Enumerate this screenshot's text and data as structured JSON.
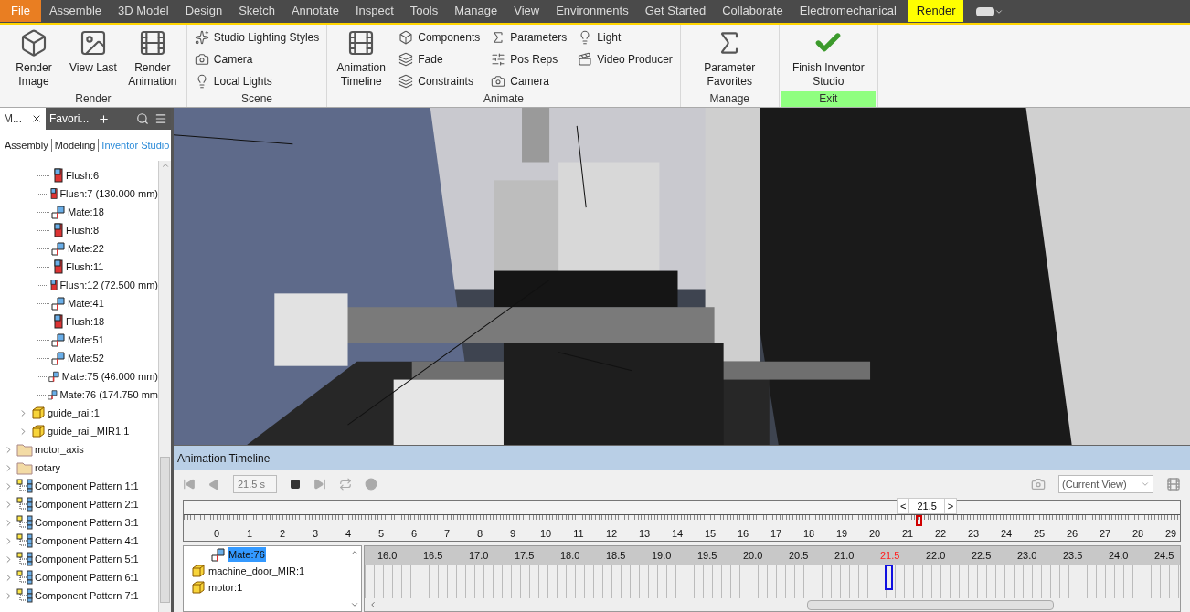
{
  "tabs": [
    {
      "label": "File",
      "kind": "file"
    },
    {
      "label": "Assemble",
      "kind": "tab",
      "selected": false
    },
    {
      "label": "3D Model",
      "kind": "tab",
      "selected": false
    },
    {
      "label": "Design",
      "kind": "tab",
      "selected": false
    },
    {
      "label": "Sketch",
      "kind": "tab",
      "selected": false
    },
    {
      "label": "Annotate",
      "kind": "tab",
      "selected": false
    },
    {
      "label": "Inspect",
      "kind": "tab",
      "selected": false
    },
    {
      "label": "Tools",
      "kind": "tab",
      "selected": false
    },
    {
      "label": "Manage",
      "kind": "tab",
      "selected": false
    },
    {
      "label": "View",
      "kind": "tab",
      "selected": false
    },
    {
      "label": "Environments",
      "kind": "tab",
      "selected": false
    },
    {
      "label": "Get Started",
      "kind": "tab",
      "selected": false
    },
    {
      "label": "Collaborate",
      "kind": "tab",
      "selected": false
    },
    {
      "label": "Electromechanical",
      "kind": "tab",
      "selected": false
    },
    {
      "label": "Render",
      "kind": "tab",
      "selected": true
    }
  ],
  "ribbon": [
    {
      "title": "Render",
      "highlighted": false,
      "tools": [
        {
          "kind": "large",
          "label": "Render Image"
        },
        {
          "kind": "large",
          "label": "View Last"
        },
        {
          "kind": "large",
          "label": "Render Animation"
        }
      ]
    },
    {
      "title": "Scene",
      "highlighted": false,
      "tools": [
        {
          "kind": "small",
          "label": "Studio Lighting Styles"
        },
        {
          "kind": "small",
          "label": "Camera"
        },
        {
          "kind": "small",
          "label": "Local Lights"
        }
      ]
    },
    {
      "title": "Animate",
      "highlighted": false,
      "tools": [
        {
          "kind": "large",
          "label": "Animation Timeline"
        },
        {
          "kind": "small",
          "label": "Components"
        },
        {
          "kind": "small",
          "label": "Fade"
        },
        {
          "kind": "small",
          "label": "Constraints"
        },
        {
          "kind": "small",
          "label": "Parameters"
        },
        {
          "kind": "small",
          "label": "Pos Reps"
        },
        {
          "kind": "small",
          "label": "Camera"
        },
        {
          "kind": "small",
          "label": "Light"
        },
        {
          "kind": "small",
          "label": "Video Producer"
        }
      ]
    },
    {
      "title": "Manage",
      "highlighted": false,
      "tools": [
        {
          "kind": "large",
          "label": "Parameter Favorites"
        }
      ]
    },
    {
      "title": "Exit",
      "highlighted": true,
      "tools": [
        {
          "kind": "large",
          "label": "Finish Inventor Studio"
        }
      ]
    }
  ],
  "browser": {
    "tabs": [
      {
        "label": "M...",
        "selected": true
      },
      {
        "label": "Favori...",
        "selected": false
      }
    ],
    "views": [
      {
        "label": "Assembly",
        "selected": false
      },
      {
        "label": "Modeling",
        "selected": false
      },
      {
        "label": "Inventor Studio",
        "selected": true
      }
    ],
    "constraints": [
      {
        "kind": "flush",
        "label": "Flush:6"
      },
      {
        "kind": "flush",
        "label": "Flush:7 (130.000 mm)"
      },
      {
        "kind": "mate",
        "label": "Mate:18"
      },
      {
        "kind": "flush",
        "label": "Flush:8"
      },
      {
        "kind": "mate",
        "label": "Mate:22"
      },
      {
        "kind": "flush",
        "label": "Flush:11"
      },
      {
        "kind": "flush",
        "label": "Flush:12 (72.500 mm)"
      },
      {
        "kind": "mate",
        "label": "Mate:41"
      },
      {
        "kind": "flush",
        "label": "Flush:18"
      },
      {
        "kind": "mate",
        "label": "Mate:51"
      },
      {
        "kind": "mate",
        "label": "Mate:52"
      },
      {
        "kind": "mate",
        "label": "Mate:75 (46.000 mm)"
      },
      {
        "kind": "mate",
        "label": "Mate:76 (174.750 mm"
      }
    ],
    "components": [
      {
        "kind": "part",
        "label": "guide_rail:1"
      },
      {
        "kind": "part",
        "label": "guide_rail_MIR1:1"
      }
    ],
    "nodes": [
      {
        "kind": "folder",
        "label": "motor_axis"
      },
      {
        "kind": "folder",
        "label": "rotary"
      },
      {
        "kind": "pattern",
        "label": "Component Pattern 1:1"
      },
      {
        "kind": "pattern",
        "label": "Component Pattern 2:1"
      },
      {
        "kind": "pattern",
        "label": "Component Pattern 3:1"
      },
      {
        "kind": "pattern",
        "label": "Component Pattern 4:1"
      },
      {
        "kind": "pattern",
        "label": "Component Pattern 5:1"
      },
      {
        "kind": "pattern",
        "label": "Component Pattern 6:1"
      },
      {
        "kind": "pattern",
        "label": "Component Pattern 7:1"
      }
    ]
  },
  "timeline": {
    "title": "Animation Timeline",
    "time": "21.5 s",
    "camera": "(Current View)",
    "scrubber": {
      "prev": "<",
      "value": "21.5",
      "next": ">"
    },
    "ruler": [
      "0",
      "1",
      "2",
      "3",
      "4",
      "5",
      "6",
      "7",
      "8",
      "9",
      "10",
      "11",
      "12",
      "13",
      "14",
      "15",
      "16",
      "17",
      "18",
      "19",
      "20",
      "21",
      "22",
      "23",
      "24",
      "25",
      "26",
      "27",
      "28",
      "29"
    ],
    "playhead": {
      "level": 0.738
    },
    "items": [
      {
        "kind": "mate",
        "label": "Mate:76",
        "selected": true
      },
      {
        "kind": "part",
        "label": "machine_door_MIR:1",
        "selected": false
      },
      {
        "kind": "part",
        "label": "motor:1",
        "selected": false
      }
    ],
    "track_times": [
      {
        "label": "16.0",
        "current": false
      },
      {
        "label": "16.5",
        "current": false
      },
      {
        "label": "17.0",
        "current": false
      },
      {
        "label": "17.5",
        "current": false
      },
      {
        "label": "18.0",
        "current": false
      },
      {
        "label": "18.5",
        "current": false
      },
      {
        "label": "19.0",
        "current": false
      },
      {
        "label": "19.5",
        "current": false
      },
      {
        "label": "20.0",
        "current": false
      },
      {
        "label": "20.5",
        "current": false
      },
      {
        "label": "21.0",
        "current": false
      },
      {
        "label": "21.5",
        "current": true
      },
      {
        "label": "22.0",
        "current": false
      },
      {
        "label": "22.5",
        "current": false
      },
      {
        "label": "23.0",
        "current": false
      },
      {
        "label": "23.5",
        "current": false
      },
      {
        "label": "24.0",
        "current": false
      },
      {
        "label": "24.5",
        "current": false
      }
    ]
  }
}
